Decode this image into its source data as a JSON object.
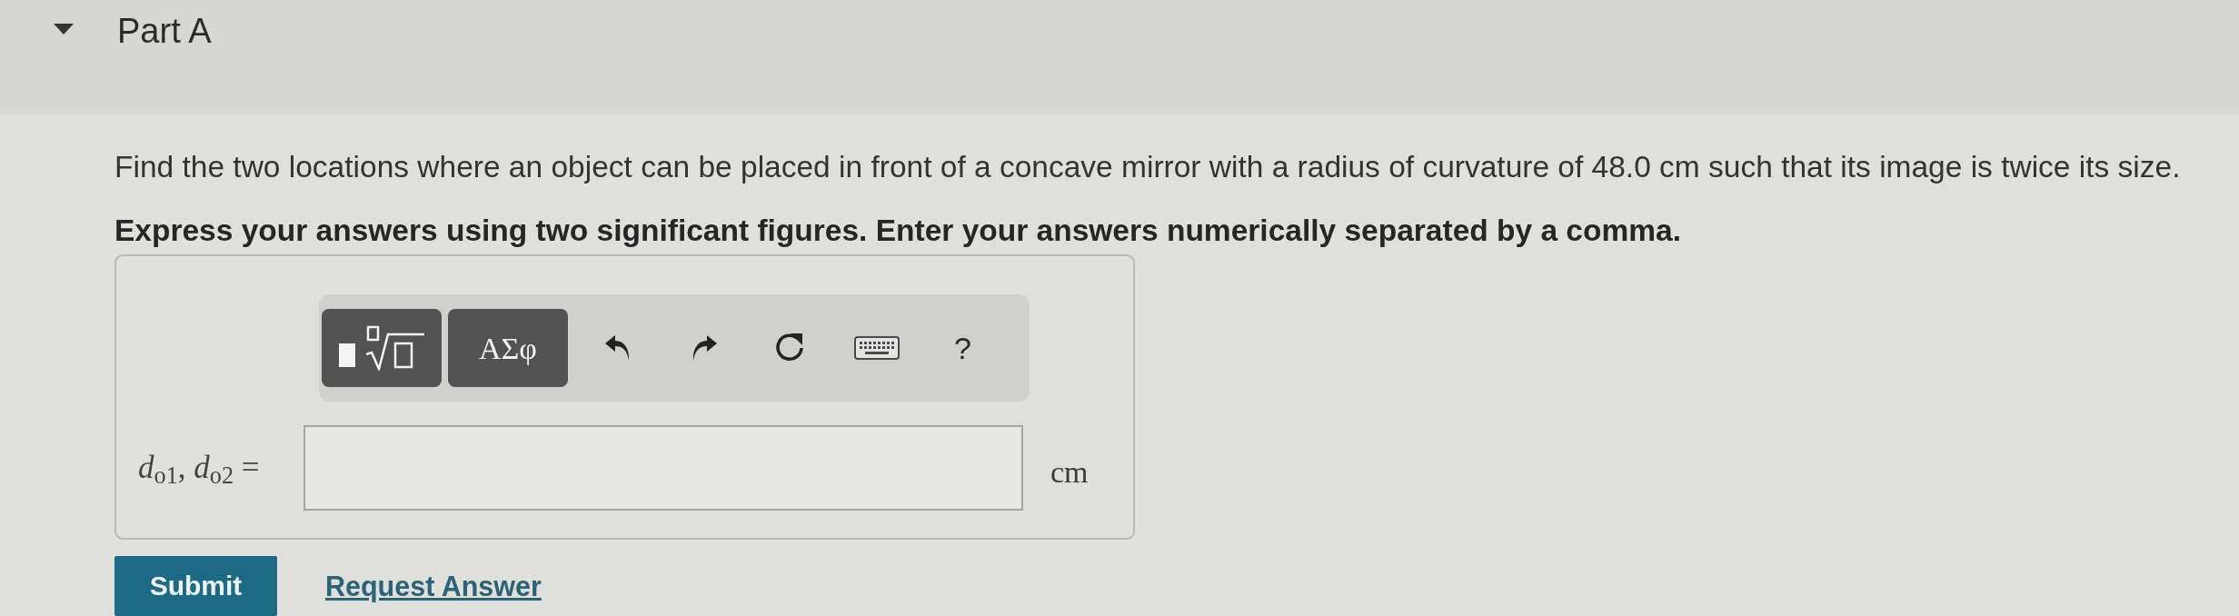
{
  "part": {
    "title": "Part A",
    "expanded": true
  },
  "question": {
    "prompt": "Find the two locations where an object can be placed in front of a concave mirror with a radius of curvature of 48.0 cm such that its image is twice its size.",
    "instruction": "Express your answers using two significant figures. Enter your answers numerically separated by a comma."
  },
  "toolbar": {
    "buttons": [
      {
        "kind": "templates"
      },
      {
        "kind": "symbols",
        "label": "ΑΣφ"
      },
      {
        "kind": "undo"
      },
      {
        "kind": "redo"
      },
      {
        "kind": "reset"
      },
      {
        "kind": "keyboard"
      },
      {
        "kind": "help",
        "label": "?"
      }
    ]
  },
  "answer": {
    "label": "*d*$_{o1}$, *d*$_{o2}$ =",
    "unit": "cm"
  },
  "actions": {
    "submit": "Submit",
    "request_answer": "Request Answer"
  }
}
